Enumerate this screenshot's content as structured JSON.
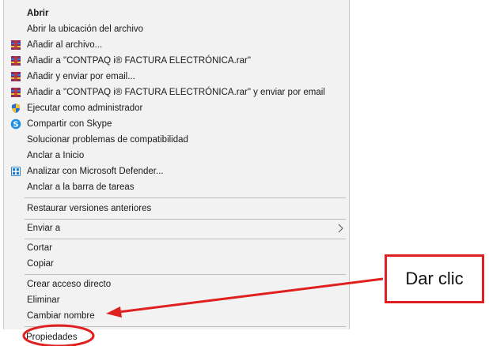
{
  "menu": {
    "items": [
      {
        "label": "Abrir",
        "bold": true,
        "icon": ""
      },
      {
        "label": "Abrir la ubicación del archivo",
        "icon": ""
      },
      {
        "label": "Añadir al archivo...",
        "icon": "winrar-icon"
      },
      {
        "label": "Añadir a \"CONTPAQ i® FACTURA ELECTRÓNICA.rar\"",
        "icon": "winrar-icon"
      },
      {
        "label": "Añadir y enviar por email...",
        "icon": "winrar-icon"
      },
      {
        "label": "Añadir a \"CONTPAQ i® FACTURA ELECTRÓNICA.rar\" y enviar por email",
        "icon": "winrar-icon"
      },
      {
        "label": "Ejecutar como administrador",
        "icon": "uac-shield-icon"
      },
      {
        "label": "Compartir con Skype",
        "icon": "skype-icon"
      },
      {
        "label": "Solucionar problemas de compatibilidad",
        "icon": ""
      },
      {
        "label": "Anclar a Inicio",
        "icon": ""
      },
      {
        "label": "Analizar con Microsoft Defender...",
        "icon": "defender-icon"
      },
      {
        "label": "Anclar a la barra de tareas",
        "icon": ""
      },
      {
        "label": "Restaurar versiones anteriores",
        "icon": ""
      },
      {
        "label": "Enviar a",
        "icon": "",
        "submenu": true
      },
      {
        "label": "Cortar",
        "icon": ""
      },
      {
        "label": "Copiar",
        "icon": ""
      },
      {
        "label": "Crear acceso directo",
        "icon": ""
      },
      {
        "label": "Eliminar",
        "icon": ""
      },
      {
        "label": "Cambiar nombre",
        "icon": ""
      },
      {
        "label": "Propiedades",
        "icon": "",
        "highlighted": true
      }
    ]
  },
  "callout": {
    "text": "Dar clic",
    "color": "#e02020"
  }
}
